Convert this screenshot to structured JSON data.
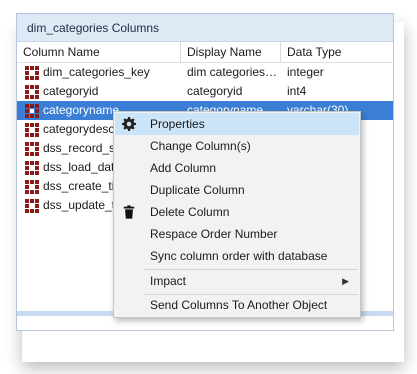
{
  "panel": {
    "title": "dim_categories Columns"
  },
  "columns": [
    "Column Name",
    "Display Name",
    "Data Type"
  ],
  "rows": [
    {
      "name": "dim_categories_key",
      "display": "dim categories…",
      "type": "integer"
    },
    {
      "name": "categoryid",
      "display": "categoryid",
      "type": "int4"
    },
    {
      "name": "categoryname",
      "display": "categoryname",
      "type": "varchar(30)"
    },
    {
      "name": "categorydesc",
      "display": "",
      "type": ""
    },
    {
      "name": "dss_record_so",
      "display": "",
      "type": ""
    },
    {
      "name": "dss_load_date",
      "display": "",
      "type": ""
    },
    {
      "name": "dss_create_tim",
      "display": "",
      "type": ""
    },
    {
      "name": "dss_update_ti",
      "display": "",
      "type": ""
    }
  ],
  "menu": {
    "items": [
      {
        "label": "Properties",
        "icon": "gear-icon"
      },
      {
        "label": "Change Column(s)"
      },
      {
        "label": "Add Column"
      },
      {
        "label": "Duplicate Column"
      },
      {
        "label": "Delete Column",
        "icon": "trash-icon"
      },
      {
        "label": "Respace Order Number"
      },
      {
        "label": "Sync column order with database"
      },
      {
        "label": "Impact",
        "submenu": true
      },
      {
        "label": "Send Columns To Another Object"
      }
    ]
  },
  "colors": {
    "selection": "#3a7fd5",
    "menu_highlight": "#cce4f7",
    "column_icon": "#8b1a1a",
    "title_bg": "#dfe9f5"
  }
}
